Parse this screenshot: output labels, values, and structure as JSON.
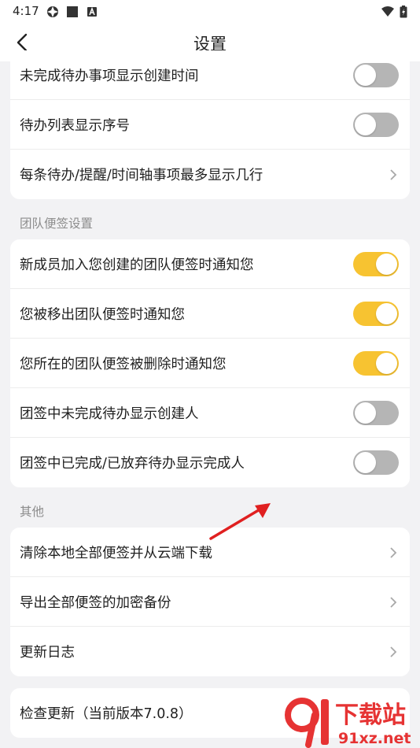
{
  "status_bar": {
    "time": "4:17",
    "icons": [
      "app-icon",
      "square-icon",
      "a-badge-icon",
      "wifi-icon",
      "battery-icon"
    ]
  },
  "header": {
    "title": "设置",
    "back_icon": "chevron-left-icon"
  },
  "colors": {
    "toggle_on": "#f7c331",
    "toggle_off": "#b5b5b5",
    "arrow": "#e02020",
    "watermark": "#e63333"
  },
  "top_card": {
    "rows": [
      {
        "label": "未完成待办事项显示创建时间",
        "control": "toggle",
        "on": false
      },
      {
        "label": "待办列表显示序号",
        "control": "toggle",
        "on": false
      },
      {
        "label": "每条待办/提醒/时间轴事项最多显示几行",
        "control": "chevron"
      }
    ]
  },
  "team_section": {
    "title": "团队便签设置",
    "rows": [
      {
        "label": "新成员加入您创建的团队便签时通知您",
        "control": "toggle",
        "on": true
      },
      {
        "label": "您被移出团队便签时通知您",
        "control": "toggle",
        "on": true
      },
      {
        "label": "您所在的团队便签被删除时通知您",
        "control": "toggle",
        "on": true
      },
      {
        "label": "团签中未完成待办显示创建人",
        "control": "toggle",
        "on": false
      },
      {
        "label": "团签中已完成/已放弃待办显示完成人",
        "control": "toggle",
        "on": false
      }
    ]
  },
  "other_section": {
    "title": "其他",
    "rows": [
      {
        "label": "清除本地全部便签并从云端下载",
        "control": "chevron"
      },
      {
        "label": "导出全部便签的加密备份",
        "control": "chevron"
      },
      {
        "label": "更新日志",
        "control": "chevron"
      }
    ]
  },
  "update_card": {
    "label": "检查更新（当前版本7.0.8）"
  },
  "watermark": {
    "brand": "下载站",
    "site": "91xz.net"
  }
}
